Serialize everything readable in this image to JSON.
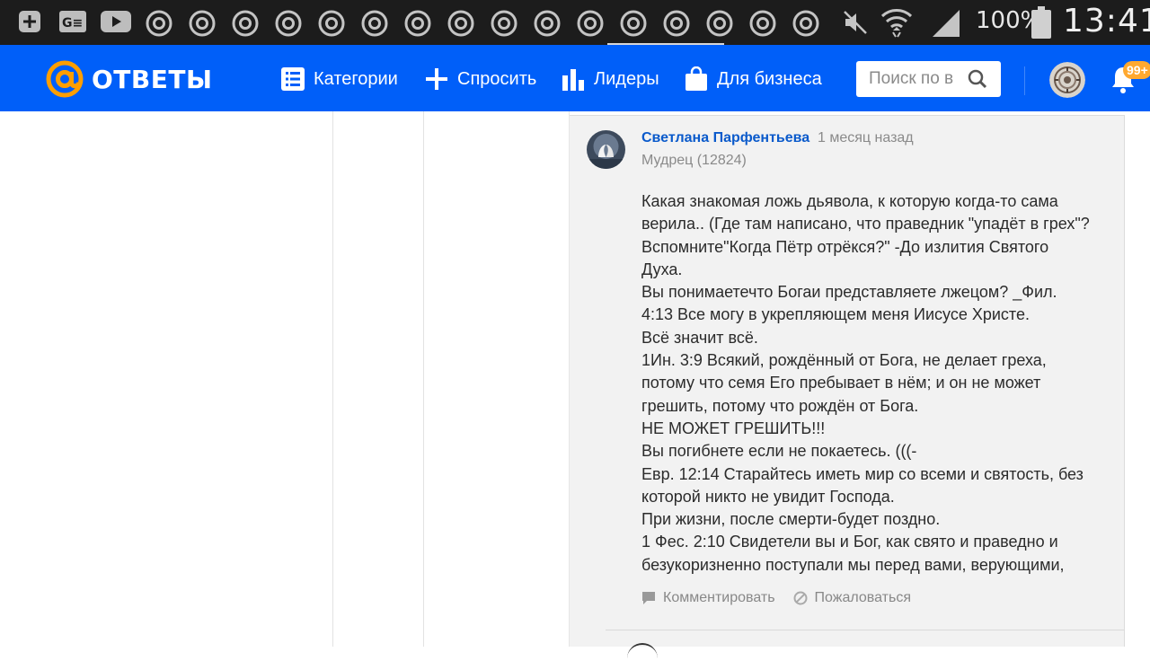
{
  "status_bar": {
    "battery": "100%",
    "clock": "13:41",
    "icons": [
      "plus-box-icon",
      "ge-news-icon",
      "youtube-icon",
      "chrome-icon",
      "mute-icon",
      "wifi-icon",
      "signal-icon",
      "battery-icon"
    ]
  },
  "header": {
    "logo_text": "ОТВЕТЫ",
    "nav": {
      "categories": "Категории",
      "ask": "Спросить",
      "leaders": "Лидеры",
      "business": "Для бизнеса"
    },
    "search_placeholder": "Поиск по в",
    "notifications_badge": "99+"
  },
  "answer": {
    "author": "Светлана Парфентьева",
    "time": "1 месяц назад",
    "rank": "Мудрец (12824)",
    "lines": [
      "Какая знакомая ложь дьявола, к которую когда-то сама",
      "верила.. (Где там написано, что праведник \"упадёт в грех\"?",
      "Вспомните\"Когда Пётр отрёкся?\" -До излития Святого",
      "Духа.",
      "Вы понимаетечто Богаи представляете лжецом? _Фил.",
      "4:13 Все могу в укрепляющем меня Иисусе Христе.",
      "Всё значит всё.",
      "1Ин. 3:9 Всякий, рождённый от Бога, не делает греха,",
      "потому что семя Его пребывает в нём; и он не может",
      "грешить, потому что рождён от Бога.",
      "НЕ МОЖЕТ ГРЕШИТЬ!!!",
      "Вы погибнете если не покаетесь. (((-",
      "Евр. 12:14 Старайтесь иметь мир со всеми и святость, без",
      "которой никто не увидит Господа.",
      "При жизни, после смерти-будет поздно.",
      "1 Фес. 2:10 Свидетели вы и Бог, как свято и праведно и",
      "безукоризненно поступали мы перед вами, верующими,"
    ],
    "comment_label": "Комментировать",
    "report_label": "Пожаловаться"
  },
  "colors": {
    "header_bg": "#005ff9",
    "logo_orange": "#ff9e00",
    "badge": "#ffa930",
    "author_link": "#0a5acb"
  }
}
